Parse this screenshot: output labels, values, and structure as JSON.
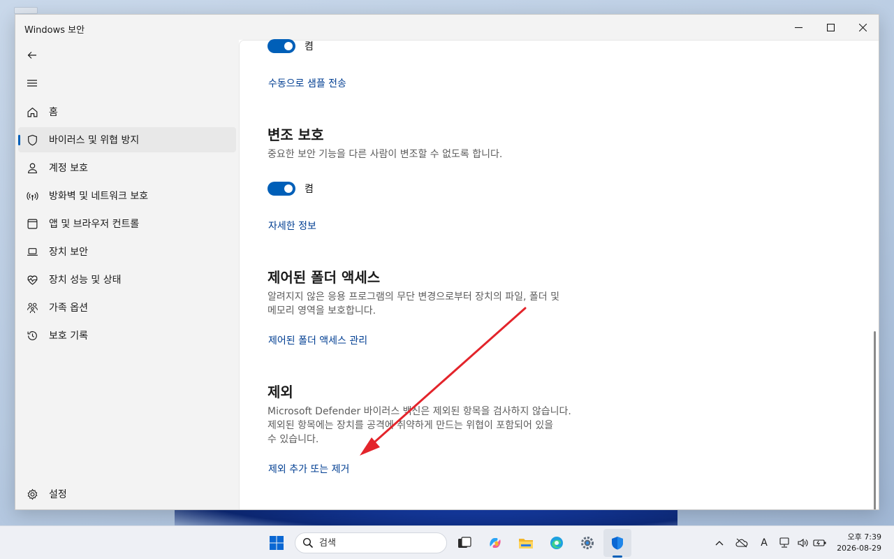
{
  "window": {
    "title": "Windows 보안"
  },
  "sidebar": {
    "items": [
      {
        "label": "홈",
        "icon": "home-icon"
      },
      {
        "label": "바이러스 및 위협 방지",
        "icon": "shield-icon",
        "active": true
      },
      {
        "label": "계정 보호",
        "icon": "person-icon"
      },
      {
        "label": "방화벽 및 네트워크 보호",
        "icon": "wireless-icon"
      },
      {
        "label": "앱 및 브라우저 컨트롤",
        "icon": "app-window-icon"
      },
      {
        "label": "장치 보안",
        "icon": "laptop-icon"
      },
      {
        "label": "장치 성능 및 상태",
        "icon": "heart-pulse-icon"
      },
      {
        "label": "가족 옵션",
        "icon": "family-icon"
      },
      {
        "label": "보호 기록",
        "icon": "history-icon"
      }
    ],
    "settings_label": "설정"
  },
  "content": {
    "top_toggle_label": "켬",
    "manual_submit_link": "수동으로 샘플 전송",
    "tamper": {
      "title": "변조 보호",
      "desc": "중요한 보안 기능을 다른 사람이 변조할 수 없도록 합니다.",
      "toggle_label": "켬",
      "link": "자세한 정보"
    },
    "cfa": {
      "title": "제어된 폴더 액세스",
      "desc_line1": "알려지지 않은 응용 프로그램의 무단 변경으로부터 장치의 파일, 폴더 및",
      "desc_line2": "메모리 영역을 보호합니다.",
      "link": "제어된 폴더 액세스 관리"
    },
    "exclusions": {
      "title": "제외",
      "desc_line1": "Microsoft Defender 바이러스 백신은 제외된 항목을 검사하지 않습니다.",
      "desc_line2": "제외된 항목에는 장치를 공격에 취약하게 만드는 위협이 포함되어 있을",
      "desc_line3": "수 있습니다.",
      "link": "제외 추가 또는 제거"
    }
  },
  "annotation": {
    "arrow_color": "#e3242b"
  },
  "taskbar": {
    "search_placeholder": "검색",
    "apps": [
      "start-icon",
      "task-view-icon",
      "copilot-icon",
      "file-explorer-icon",
      "edge-icon",
      "settings-icon",
      "windows-security-icon"
    ],
    "tray": {
      "ime": "A"
    },
    "clock_time": "오후 7:39",
    "clock_date": "2026-08-29"
  }
}
